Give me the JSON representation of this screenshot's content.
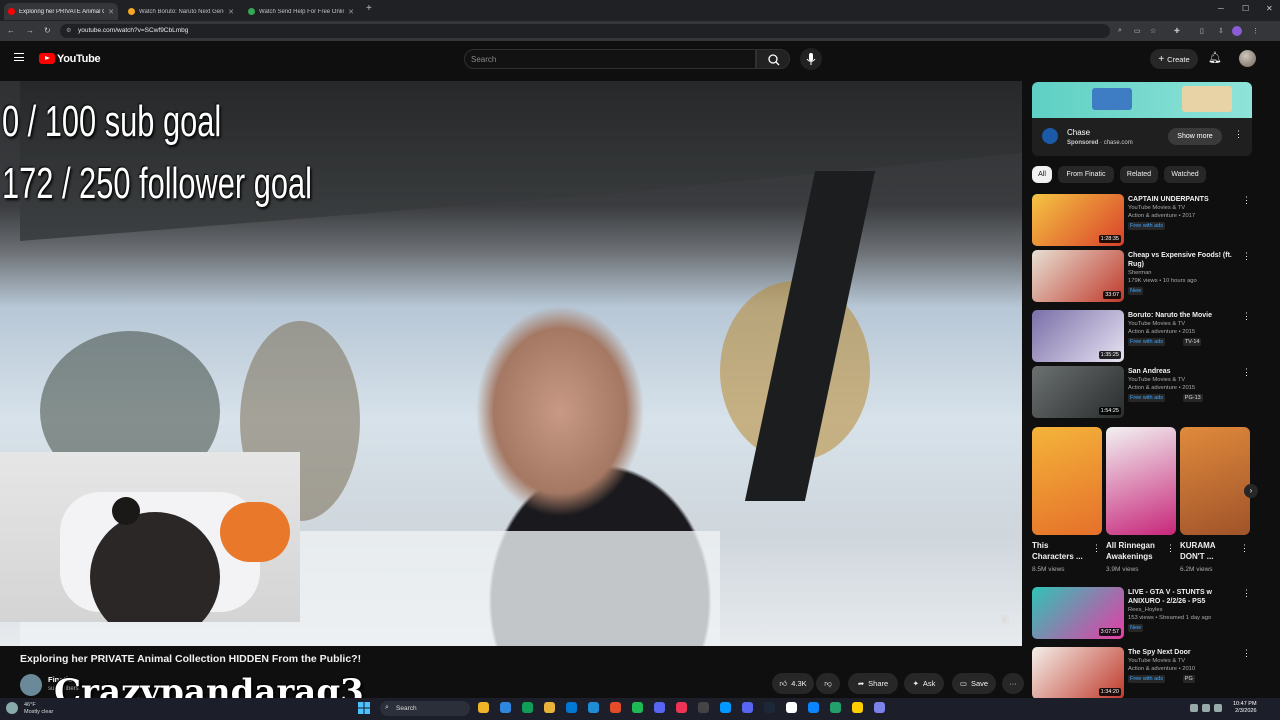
{
  "browser": {
    "tabs": [
      {
        "title": "Exploring her PRIVATE Animal Collection",
        "active": true,
        "favicon_color": "#ff0000"
      },
      {
        "title": "Watch Boruto: Naruto Next Generations",
        "active": false,
        "favicon_color": "#f5a623"
      },
      {
        "title": "Watch Send Help For Free Online",
        "active": false,
        "favicon_color": "#34a853"
      }
    ],
    "new_tab_icon": "+",
    "url": "youtube.com/watch?v=SCwf9CbLmbg"
  },
  "youtube": {
    "logo_text": "YouTube",
    "search_placeholder": "Search",
    "create_label": "Create"
  },
  "video": {
    "overlay_line1": "0 / 100 sub goal",
    "overlay_line2": "172 / 250 follower goal",
    "title": "Exploring her PRIVATE Animal Collection HIDDEN From the Public?!",
    "channel": "Finatic",
    "subs": "subscribers",
    "watermark": "Crazypandarag3",
    "likes": "4.3K",
    "share_label": "Share",
    "ask_label": "Ask",
    "save_label": "Save"
  },
  "ad": {
    "name": "Chase",
    "sponsored": "Sponsored",
    "domain": "chase.com",
    "button": "Show more"
  },
  "chips": [
    "All",
    "From Finatic",
    "Related",
    "Watched"
  ],
  "recommendations": [
    {
      "title": "CAPTAIN UNDERPANTS",
      "channel": "YouTube Movies & TV",
      "meta": "Action & adventure • 2017",
      "badge": "Free with ads",
      "rating": "",
      "duration": "1:28:35",
      "colors": [
        "#f5c542",
        "#d9412b"
      ]
    },
    {
      "title": "Cheap vs Expensive Foods! (ft. Rug)",
      "channel": "Sherman",
      "meta": "179K views • 10 hours ago",
      "badge": "New",
      "rating": "",
      "duration": "33:07",
      "colors": [
        "#e7e0d4",
        "#c0392b"
      ]
    },
    {
      "title": "Boruto: Naruto the Movie",
      "channel": "YouTube Movies & TV",
      "meta": "Action & adventure • 2015",
      "badge": "Free with ads",
      "rating": "TV-14",
      "duration": "1:35:25",
      "colors": [
        "#7a6fa8",
        "#e8e2f2"
      ]
    },
    {
      "title": "San Andreas",
      "channel": "YouTube Movies & TV",
      "meta": "Action & adventure • 2015",
      "badge": "Free with ads",
      "rating": "PG-13",
      "duration": "1:54:25",
      "colors": [
        "#6b7070",
        "#2a2d2e"
      ]
    }
  ],
  "shorts": [
    {
      "title": "This Characters ...",
      "views": "8.5M views",
      "colors": [
        "#f4b43a",
        "#e5702a"
      ]
    },
    {
      "title": "All Rinnegan Awakenings",
      "views": "3.9M views",
      "colors": [
        "#f2f2f2",
        "#c7267a"
      ]
    },
    {
      "title": "KURAMA DON'T ...",
      "views": "6.2M views",
      "colors": [
        "#e08a3c",
        "#a0532a"
      ]
    }
  ],
  "recommendations2": [
    {
      "title": "LIVE - GTA V - STUNTS w ANIXURO - 2/2/26 - PS5",
      "channel": "Rees_Hoyles",
      "meta": "153 views • Streamed 1 day ago",
      "badge": "New",
      "rating": "",
      "duration": "3:07:57",
      "colors": [
        "#2ec4b6",
        "#e63ca5"
      ]
    },
    {
      "title": "The Spy Next Door",
      "channel": "YouTube Movies & TV",
      "meta": "Action & adventure • 2010",
      "badge": "Free with ads",
      "rating": "PG",
      "duration": "1:34:20",
      "colors": [
        "#f3efe9",
        "#c0392b"
      ]
    }
  ],
  "taskbar": {
    "weather_temp": "46°F",
    "weather_desc": "Mostly clear",
    "search": "Search",
    "time": "10:47 PM",
    "date": "2/3/2026"
  }
}
